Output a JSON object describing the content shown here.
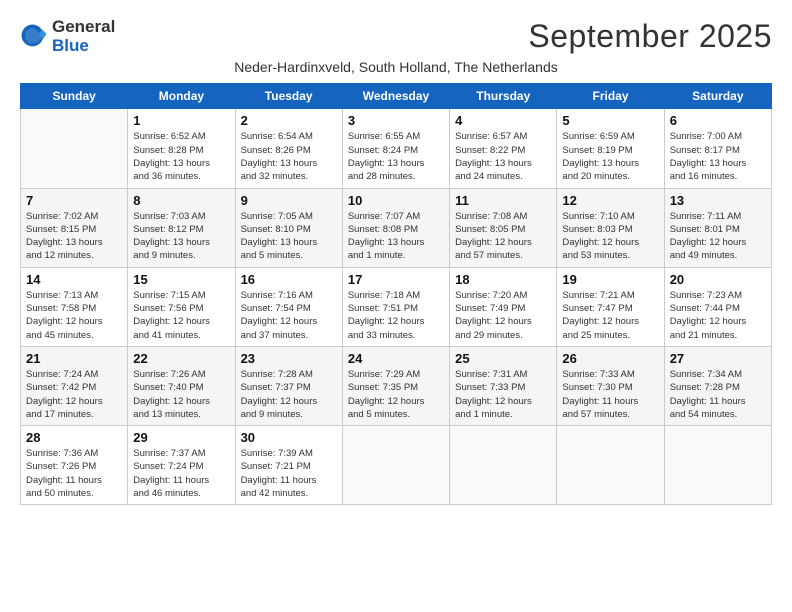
{
  "logo": {
    "general": "General",
    "blue": "Blue"
  },
  "header": {
    "month_title": "September 2025",
    "location": "Neder-Hardinxveld, South Holland, The Netherlands"
  },
  "weekdays": [
    "Sunday",
    "Monday",
    "Tuesday",
    "Wednesday",
    "Thursday",
    "Friday",
    "Saturday"
  ],
  "weeks": [
    [
      {
        "day": "",
        "info": ""
      },
      {
        "day": "1",
        "info": "Sunrise: 6:52 AM\nSunset: 8:28 PM\nDaylight: 13 hours\nand 36 minutes."
      },
      {
        "day": "2",
        "info": "Sunrise: 6:54 AM\nSunset: 8:26 PM\nDaylight: 13 hours\nand 32 minutes."
      },
      {
        "day": "3",
        "info": "Sunrise: 6:55 AM\nSunset: 8:24 PM\nDaylight: 13 hours\nand 28 minutes."
      },
      {
        "day": "4",
        "info": "Sunrise: 6:57 AM\nSunset: 8:22 PM\nDaylight: 13 hours\nand 24 minutes."
      },
      {
        "day": "5",
        "info": "Sunrise: 6:59 AM\nSunset: 8:19 PM\nDaylight: 13 hours\nand 20 minutes."
      },
      {
        "day": "6",
        "info": "Sunrise: 7:00 AM\nSunset: 8:17 PM\nDaylight: 13 hours\nand 16 minutes."
      }
    ],
    [
      {
        "day": "7",
        "info": "Sunrise: 7:02 AM\nSunset: 8:15 PM\nDaylight: 13 hours\nand 12 minutes."
      },
      {
        "day": "8",
        "info": "Sunrise: 7:03 AM\nSunset: 8:12 PM\nDaylight: 13 hours\nand 9 minutes."
      },
      {
        "day": "9",
        "info": "Sunrise: 7:05 AM\nSunset: 8:10 PM\nDaylight: 13 hours\nand 5 minutes."
      },
      {
        "day": "10",
        "info": "Sunrise: 7:07 AM\nSunset: 8:08 PM\nDaylight: 13 hours\nand 1 minute."
      },
      {
        "day": "11",
        "info": "Sunrise: 7:08 AM\nSunset: 8:05 PM\nDaylight: 12 hours\nand 57 minutes."
      },
      {
        "day": "12",
        "info": "Sunrise: 7:10 AM\nSunset: 8:03 PM\nDaylight: 12 hours\nand 53 minutes."
      },
      {
        "day": "13",
        "info": "Sunrise: 7:11 AM\nSunset: 8:01 PM\nDaylight: 12 hours\nand 49 minutes."
      }
    ],
    [
      {
        "day": "14",
        "info": "Sunrise: 7:13 AM\nSunset: 7:58 PM\nDaylight: 12 hours\nand 45 minutes."
      },
      {
        "day": "15",
        "info": "Sunrise: 7:15 AM\nSunset: 7:56 PM\nDaylight: 12 hours\nand 41 minutes."
      },
      {
        "day": "16",
        "info": "Sunrise: 7:16 AM\nSunset: 7:54 PM\nDaylight: 12 hours\nand 37 minutes."
      },
      {
        "day": "17",
        "info": "Sunrise: 7:18 AM\nSunset: 7:51 PM\nDaylight: 12 hours\nand 33 minutes."
      },
      {
        "day": "18",
        "info": "Sunrise: 7:20 AM\nSunset: 7:49 PM\nDaylight: 12 hours\nand 29 minutes."
      },
      {
        "day": "19",
        "info": "Sunrise: 7:21 AM\nSunset: 7:47 PM\nDaylight: 12 hours\nand 25 minutes."
      },
      {
        "day": "20",
        "info": "Sunrise: 7:23 AM\nSunset: 7:44 PM\nDaylight: 12 hours\nand 21 minutes."
      }
    ],
    [
      {
        "day": "21",
        "info": "Sunrise: 7:24 AM\nSunset: 7:42 PM\nDaylight: 12 hours\nand 17 minutes."
      },
      {
        "day": "22",
        "info": "Sunrise: 7:26 AM\nSunset: 7:40 PM\nDaylight: 12 hours\nand 13 minutes."
      },
      {
        "day": "23",
        "info": "Sunrise: 7:28 AM\nSunset: 7:37 PM\nDaylight: 12 hours\nand 9 minutes."
      },
      {
        "day": "24",
        "info": "Sunrise: 7:29 AM\nSunset: 7:35 PM\nDaylight: 12 hours\nand 5 minutes."
      },
      {
        "day": "25",
        "info": "Sunrise: 7:31 AM\nSunset: 7:33 PM\nDaylight: 12 hours\nand 1 minute."
      },
      {
        "day": "26",
        "info": "Sunrise: 7:33 AM\nSunset: 7:30 PM\nDaylight: 11 hours\nand 57 minutes."
      },
      {
        "day": "27",
        "info": "Sunrise: 7:34 AM\nSunset: 7:28 PM\nDaylight: 11 hours\nand 54 minutes."
      }
    ],
    [
      {
        "day": "28",
        "info": "Sunrise: 7:36 AM\nSunset: 7:26 PM\nDaylight: 11 hours\nand 50 minutes."
      },
      {
        "day": "29",
        "info": "Sunrise: 7:37 AM\nSunset: 7:24 PM\nDaylight: 11 hours\nand 46 minutes."
      },
      {
        "day": "30",
        "info": "Sunrise: 7:39 AM\nSunset: 7:21 PM\nDaylight: 11 hours\nand 42 minutes."
      },
      {
        "day": "",
        "info": ""
      },
      {
        "day": "",
        "info": ""
      },
      {
        "day": "",
        "info": ""
      },
      {
        "day": "",
        "info": ""
      }
    ]
  ]
}
